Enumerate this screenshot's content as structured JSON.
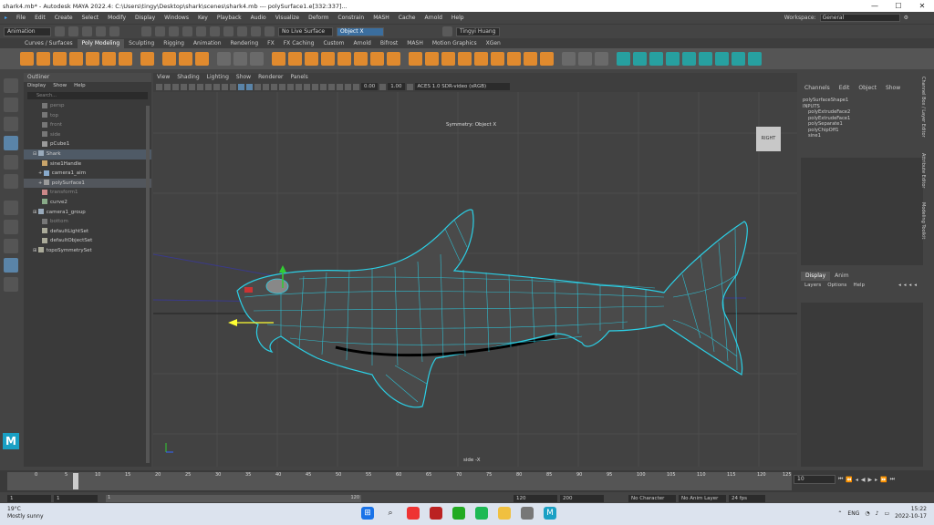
{
  "window": {
    "title": "shark4.mb* - Autodesk MAYA 2022.4: C:\\Users\\tingy\\Desktop\\shark\\scenes\\shark4.mb   ---   polySurface1.e[332:337]...",
    "minimize": "—",
    "maximize": "☐",
    "close": "✕"
  },
  "menubar": [
    "File",
    "Edit",
    "Create",
    "Select",
    "Modify",
    "Display",
    "Windows",
    "Key",
    "Playback",
    "Audio",
    "Visualize",
    "Deform",
    "Constrain",
    "MASH",
    "Cache",
    "Arnold",
    "Help"
  ],
  "workspace": {
    "label": "Workspace:",
    "value": "General"
  },
  "statusline": {
    "mode": "Animation",
    "live_surface": "No Live Surface",
    "symmetry": "Object X",
    "user": "Tingyi Huang"
  },
  "shelf_tabs": [
    "Curves / Surfaces",
    "Poly Modeling",
    "Sculpting",
    "Rigging",
    "Animation",
    "Rendering",
    "FX",
    "FX Caching",
    "Custom",
    "Arnold",
    "Bifrost",
    "MASH",
    "Motion Graphics",
    "XGen"
  ],
  "shelf_active": "Poly Modeling",
  "outliner": {
    "title": "Outliner",
    "menu": [
      "Display",
      "Show",
      "Help"
    ],
    "search_placeholder": "Search...",
    "items": [
      {
        "label": "persp",
        "dim": true
      },
      {
        "label": "top",
        "dim": true
      },
      {
        "label": "front",
        "dim": true
      },
      {
        "label": "side",
        "dim": true
      },
      {
        "label": "pCube1",
        "dim": false
      },
      {
        "label": "Shark",
        "dim": false
      },
      {
        "label": "sine1Handle",
        "dim": false
      },
      {
        "label": "camera1_aim",
        "dim": false
      },
      {
        "label": "polySurface1",
        "dim": false
      },
      {
        "label": "transform1",
        "dim": true
      },
      {
        "label": "curve2",
        "dim": false
      },
      {
        "label": "camera1_group",
        "dim": false
      },
      {
        "label": "bottom",
        "dim": true
      },
      {
        "label": "defaultLightSet",
        "dim": false
      },
      {
        "label": "defaultObjectSet",
        "dim": false
      },
      {
        "label": "topoSymmetrySet",
        "dim": false
      }
    ]
  },
  "viewport": {
    "menu": [
      "View",
      "Shading",
      "Lighting",
      "Show",
      "Renderer",
      "Panels"
    ],
    "exposure": "0.00",
    "gamma": "1.00",
    "colorspace": "ACES 1.0 SDR-video (sRGB)",
    "symmetry_label": "Symmetry: Object X",
    "camera_label": "side -X",
    "viewcube": "RIGHT"
  },
  "channelbox": {
    "menu": [
      "Channels",
      "Edit",
      "Object",
      "Show"
    ],
    "shape": "polySurfaceShape1",
    "inputs_label": "INPUTS",
    "inputs": [
      "polyExtrudeFace2",
      "polyExtrudeFace1",
      "polySeparate1",
      "polyChipOff1",
      "sine1"
    ]
  },
  "layers": {
    "tabs": [
      "Display",
      "Anim"
    ],
    "menu": [
      "Layers",
      "Options",
      "Help"
    ]
  },
  "side_tabs": [
    "Channel Box / Layer Editor",
    "Attribute Editor",
    "Modeling Toolkit"
  ],
  "timeline": {
    "ticks": [
      "0",
      "5",
      "10",
      "15",
      "20",
      "25",
      "30",
      "35",
      "40",
      "45",
      "50",
      "55",
      "60",
      "65",
      "70",
      "75",
      "80",
      "85",
      "90",
      "95",
      "100",
      "105",
      "110",
      "115",
      "120",
      "125"
    ],
    "current_frame": "10",
    "range_start": "1",
    "range_inner_start": "1",
    "range_inner_end": "120",
    "range_end": "120",
    "anim_end": "200",
    "anim_field": "120",
    "character_set": "No Character Set",
    "anim_layer": "No Anim Layer",
    "fps": "24 fps"
  },
  "taskbar": {
    "temp": "19°C",
    "weather": "Mostly sunny",
    "lang": "ENG",
    "time": "15:22",
    "date": "2022-10-17"
  }
}
